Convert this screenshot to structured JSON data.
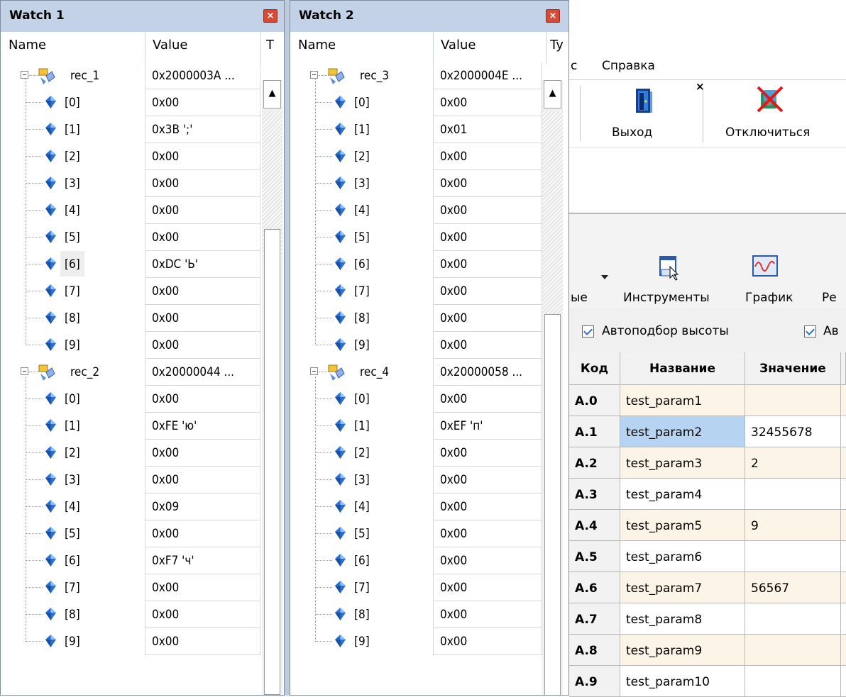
{
  "watch1": {
    "title": "Watch 1",
    "columns": {
      "name": "Name",
      "value": "Value",
      "type": "T"
    },
    "groups": [
      {
        "name": "rec_1",
        "value": "0x2000003A ...",
        "items": [
          {
            "index": "[0]",
            "value": "0x00"
          },
          {
            "index": "[1]",
            "value": "0x3B ';'"
          },
          {
            "index": "[2]",
            "value": "0x00"
          },
          {
            "index": "[3]",
            "value": "0x00"
          },
          {
            "index": "[4]",
            "value": "0x00"
          },
          {
            "index": "[5]",
            "value": "0x00"
          },
          {
            "index": "[6]",
            "value": "0xDC 'Ь'"
          },
          {
            "index": "[7]",
            "value": "0x00"
          },
          {
            "index": "[8]",
            "value": "0x00"
          },
          {
            "index": "[9]",
            "value": "0x00"
          }
        ]
      },
      {
        "name": "rec_2",
        "value": "0x20000044 ...",
        "items": [
          {
            "index": "[0]",
            "value": "0x00"
          },
          {
            "index": "[1]",
            "value": "0xFE 'ю'"
          },
          {
            "index": "[2]",
            "value": "0x00"
          },
          {
            "index": "[3]",
            "value": "0x00"
          },
          {
            "index": "[4]",
            "value": "0x09"
          },
          {
            "index": "[5]",
            "value": "0x00"
          },
          {
            "index": "[6]",
            "value": "0xF7 'ч'"
          },
          {
            "index": "[7]",
            "value": "0x00"
          },
          {
            "index": "[8]",
            "value": "0x00"
          },
          {
            "index": "[9]",
            "value": "0x00"
          }
        ]
      }
    ]
  },
  "watch2": {
    "title": "Watch 2",
    "columns": {
      "name": "Name",
      "value": "Value",
      "type": "Ty"
    },
    "groups": [
      {
        "name": "rec_3",
        "value": "0x2000004E ...",
        "items": [
          {
            "index": "[0]",
            "value": "0x00"
          },
          {
            "index": "[1]",
            "value": "0x01"
          },
          {
            "index": "[2]",
            "value": "0x00"
          },
          {
            "index": "[3]",
            "value": "0x00"
          },
          {
            "index": "[4]",
            "value": "0x00"
          },
          {
            "index": "[5]",
            "value": "0x00"
          },
          {
            "index": "[6]",
            "value": "0x00"
          },
          {
            "index": "[7]",
            "value": "0x00"
          },
          {
            "index": "[8]",
            "value": "0x00"
          },
          {
            "index": "[9]",
            "value": "0x00"
          }
        ]
      },
      {
        "name": "rec_4",
        "value": "0x20000058 ...",
        "items": [
          {
            "index": "[0]",
            "value": "0x00"
          },
          {
            "index": "[1]",
            "value": "0xEF 'п'"
          },
          {
            "index": "[2]",
            "value": "0x00"
          },
          {
            "index": "[3]",
            "value": "0x00"
          },
          {
            "index": "[4]",
            "value": "0x00"
          },
          {
            "index": "[5]",
            "value": "0x00"
          },
          {
            "index": "[6]",
            "value": "0x00"
          },
          {
            "index": "[7]",
            "value": "0x00"
          },
          {
            "index": "[8]",
            "value": "0x00"
          },
          {
            "index": "[9]",
            "value": "0x00"
          }
        ]
      }
    ]
  },
  "app": {
    "menu": {
      "partial_item": "с",
      "help": "Справка"
    },
    "toolbar": {
      "exit_label": "Выход",
      "disconnect_label": "Отключиться",
      "close_glyph": "×"
    },
    "toolbar2": {
      "partial_label": "ые",
      "tools_label": "Инструменты",
      "chart_label": "График",
      "mode_partial_label": "Ре"
    },
    "options": {
      "autofit_height": "Автоподбор высоты",
      "auto_partial": "Ав"
    },
    "table": {
      "headers": {
        "code": "Код",
        "name": "Название",
        "value": "Значение"
      },
      "rows": [
        {
          "code": "A.0",
          "name": "test_param1",
          "value": ""
        },
        {
          "code": "A.1",
          "name": "test_param2",
          "value": "32455678"
        },
        {
          "code": "A.2",
          "name": "test_param3",
          "value": "2"
        },
        {
          "code": "A.3",
          "name": "test_param4",
          "value": ""
        },
        {
          "code": "A.4",
          "name": "test_param5",
          "value": "9"
        },
        {
          "code": "A.5",
          "name": "test_param6",
          "value": ""
        },
        {
          "code": "A.6",
          "name": "test_param7",
          "value": "56567"
        },
        {
          "code": "A.7",
          "name": "test_param8",
          "value": ""
        },
        {
          "code": "A.8",
          "name": "test_param9",
          "value": ""
        },
        {
          "code": "A.9",
          "name": "test_param10",
          "value": ""
        }
      ]
    }
  }
}
